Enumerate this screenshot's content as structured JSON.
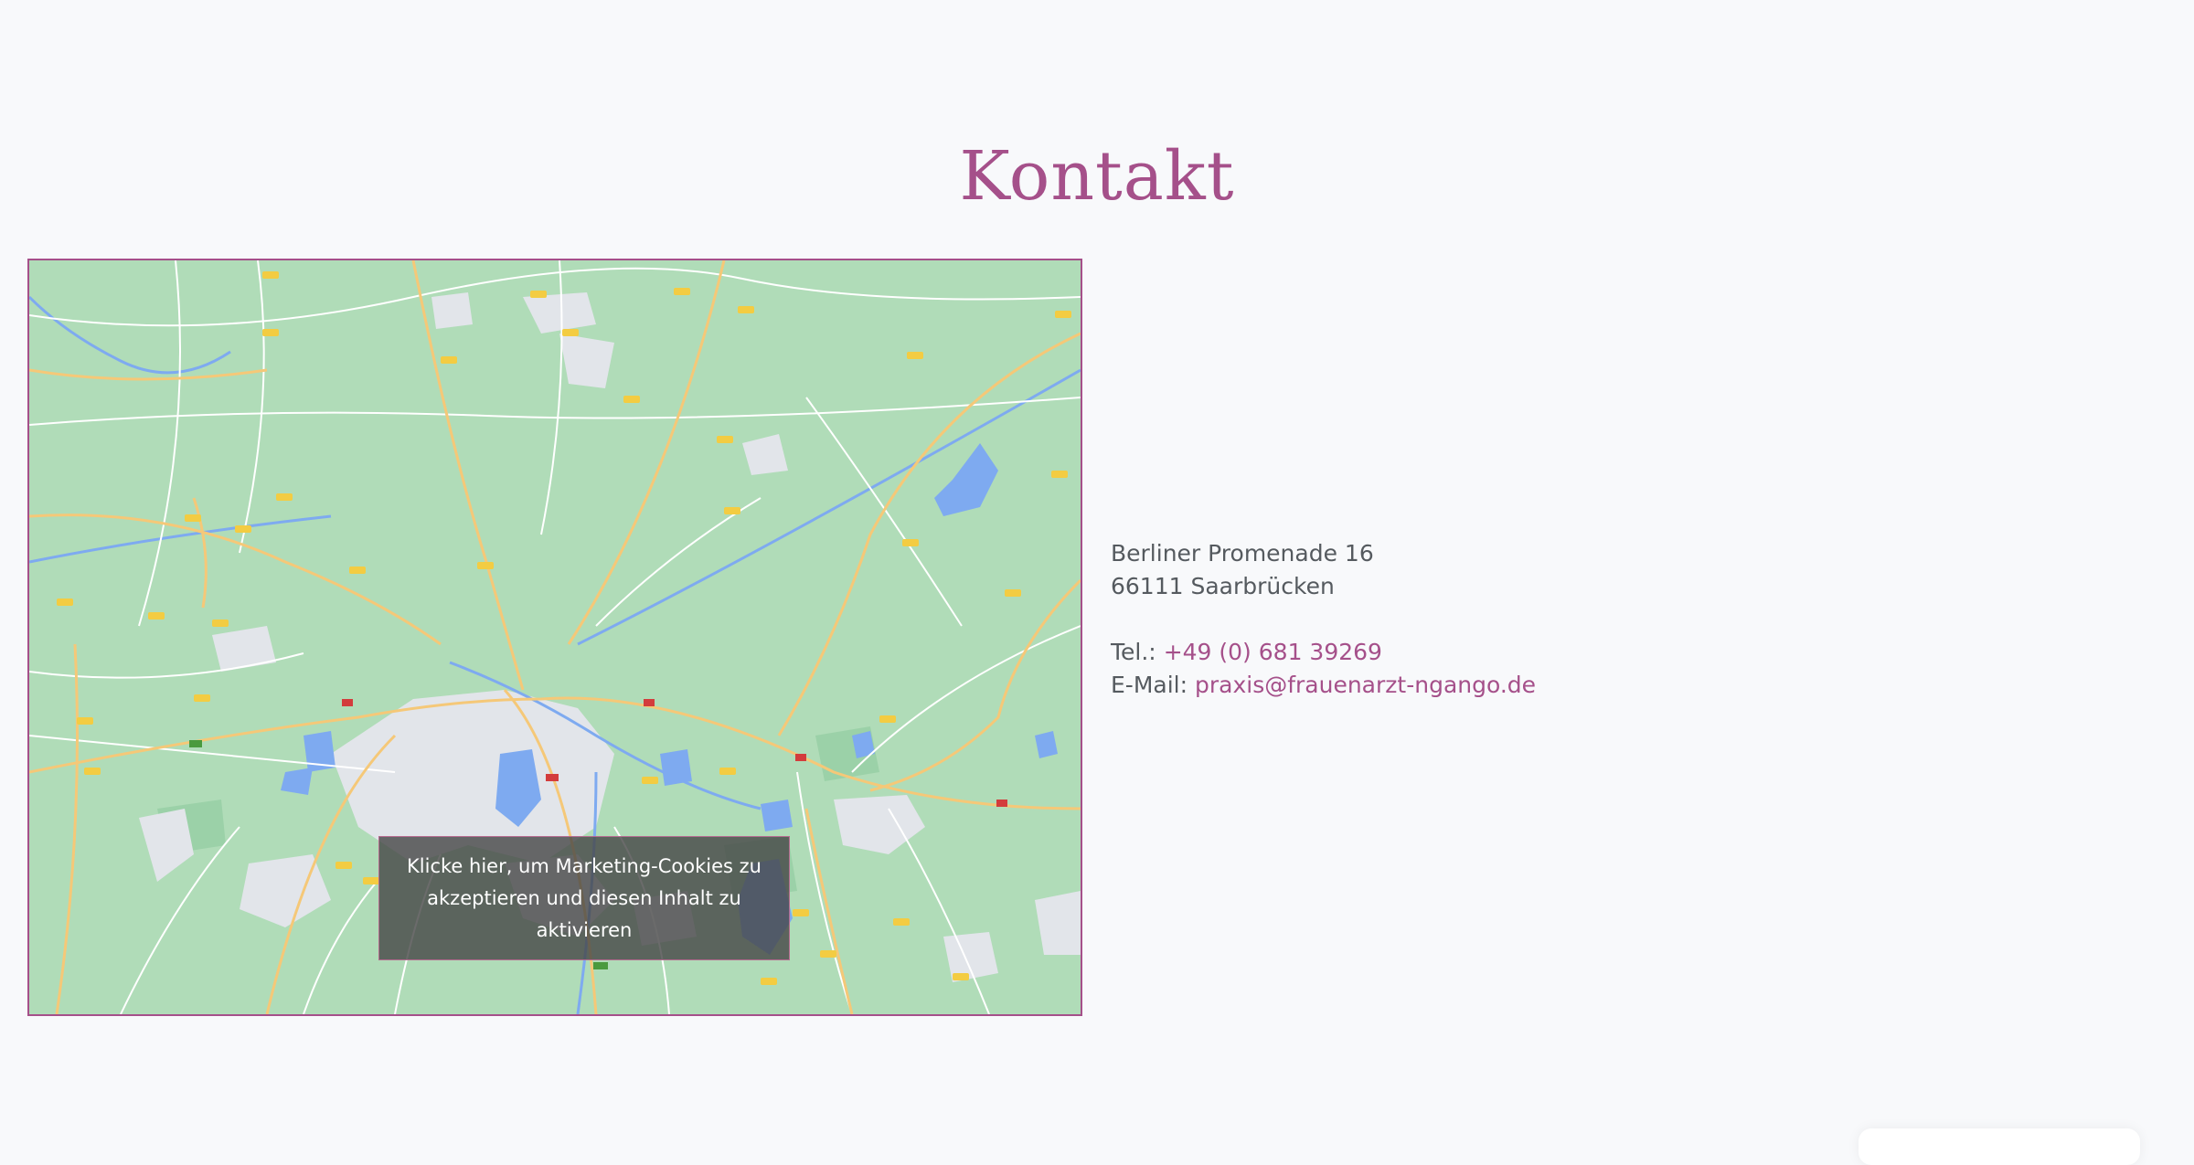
{
  "heading": "Kontakt",
  "map": {
    "consent_text": "Klicke hier, um Marketing-Cookies zu akzeptieren und diesen Inhalt zu aktivieren",
    "colors": {
      "land": "#b0dcb8",
      "urban": "#e4e6ea",
      "water": "#7eaaf0",
      "road_major": "#f5c878",
      "road_minor": "#ffffff",
      "accent_border": "#a5508a"
    }
  },
  "contact": {
    "street": "Berliner Promenade 16",
    "city": "66111 Saarbrücken",
    "tel_label": "Tel.:",
    "tel_value": "+49 (0) 681 39269",
    "email_label": "E-Mail:",
    "email_value": "praxis@frauenarzt-ngango.de"
  },
  "colors": {
    "accent": "#a5508a",
    "background": "#f8f9fb",
    "text": "#555a5f"
  }
}
